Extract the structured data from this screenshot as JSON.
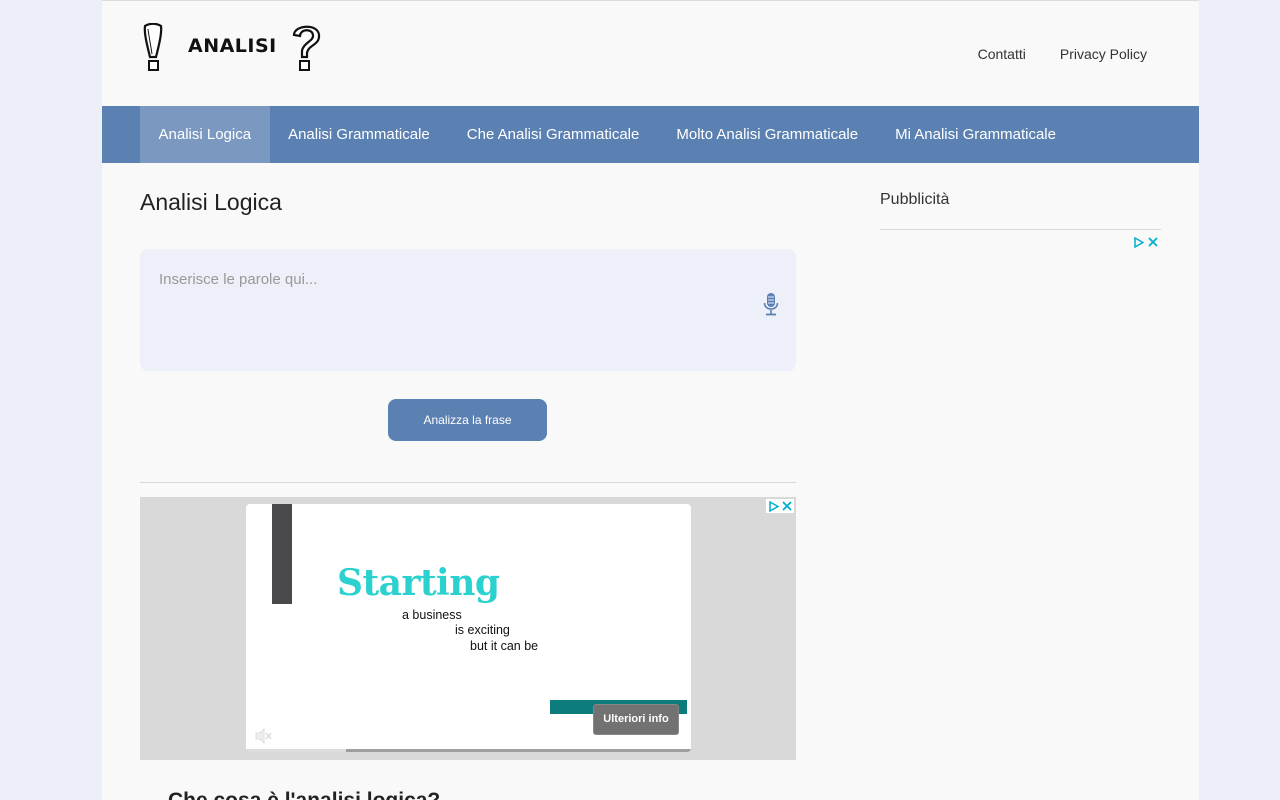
{
  "header": {
    "logo_text": "ANALISI",
    "links": [
      {
        "label": "Contatti"
      },
      {
        "label": "Privacy Policy"
      }
    ]
  },
  "nav": {
    "items": [
      {
        "label": "Analisi Logica",
        "active": true
      },
      {
        "label": "Analisi Grammaticale",
        "active": false
      },
      {
        "label": "Che Analisi Grammaticale",
        "active": false
      },
      {
        "label": "Molto Analisi Grammaticale",
        "active": false
      },
      {
        "label": "Mi Analisi Grammaticale",
        "active": false
      }
    ]
  },
  "main": {
    "title": "Analisi Logica",
    "input": {
      "placeholder": "Inserisce le parole qui...",
      "value": ""
    },
    "analyze_label": "Analizza la frase",
    "section_title": "Che cosa è l'analisi logica?"
  },
  "ad": {
    "headline": "Starting",
    "line1": "a business",
    "line2": "is exciting",
    "line3": "but it can be",
    "cta_label": "Ulteriori info"
  },
  "sidebar": {
    "title": "Pubblicità"
  },
  "colors": {
    "accent": "#5b80b2",
    "nav_active": "#7b98c1",
    "ad_headline": "#2bd1cf",
    "ad_teal": "#0b7b7b",
    "adchoices": "#00aecd"
  }
}
